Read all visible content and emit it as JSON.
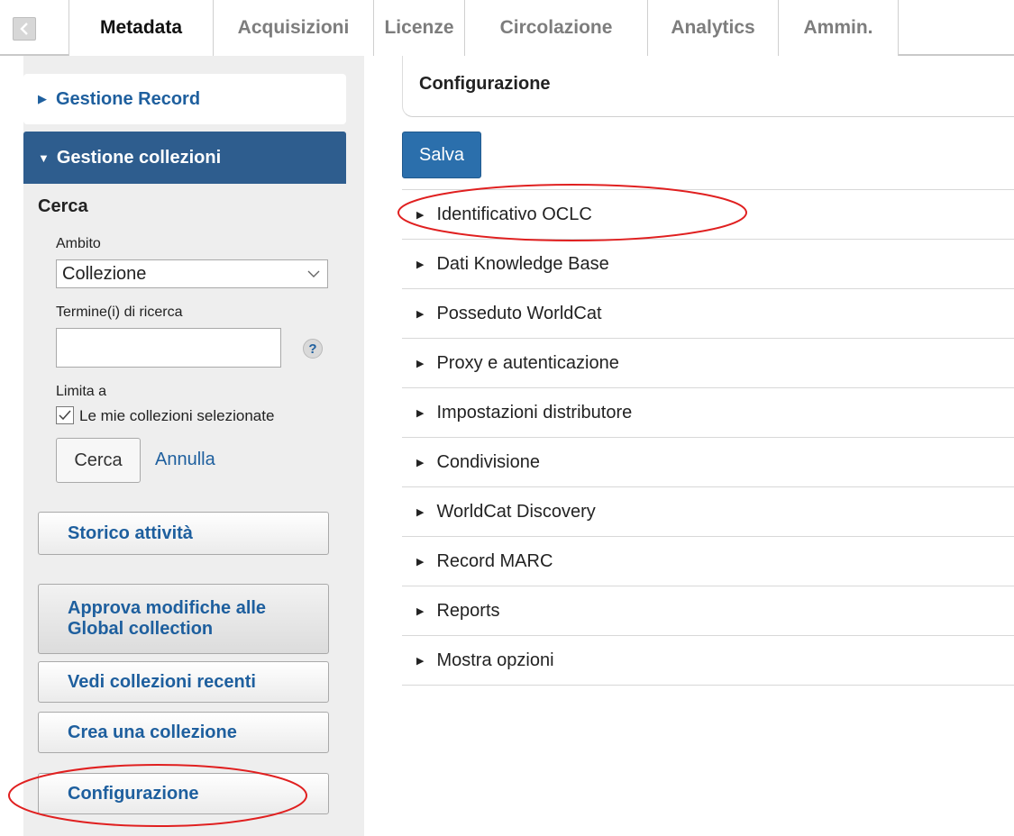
{
  "topbar": {
    "tabs": [
      {
        "label": "Metadata",
        "width": 160,
        "active": true
      },
      {
        "label": "Acquisizioni",
        "width": 178
      },
      {
        "label": "Licenze",
        "width": 101
      },
      {
        "label": "Circolazione",
        "width": 203
      },
      {
        "label": "Analytics",
        "width": 145
      },
      {
        "label": "Ammin.",
        "width": 134
      }
    ]
  },
  "sidebar": {
    "record_panel": "Gestione Record",
    "collections_panel": "Gestione collezioni",
    "search": {
      "title": "Cerca",
      "scope_label": "Ambito",
      "scope_value": "Collezione",
      "terms_label": "Termine(i) di ricerca",
      "terms_value": "",
      "help": "?",
      "limit_label": "Limita a",
      "checkbox_label": "Le mie collezioni selezionate",
      "checkbox_checked": true,
      "search_button": "Cerca",
      "cancel_link": "Annulla"
    },
    "buttons": {
      "history": "Storico attività",
      "approve_line1": "Approva modifiche alle",
      "approve_line2": "Global collection",
      "recent": "Vedi collezioni recenti",
      "create": "Crea una collezione",
      "config": "Configurazione"
    }
  },
  "main": {
    "title": "Configurazione",
    "save_button": "Salva",
    "sections": [
      "Identificativo OCLC",
      "Dati Knowledge Base",
      "Posseduto WorldCat",
      "Proxy e autenticazione",
      "Impostazioni distributore",
      "Condivisione",
      "WorldCat Discovery",
      "Record MARC",
      "Reports",
      "Mostra opzioni"
    ]
  },
  "colors": {
    "accent": "#2e5d8e",
    "link": "#1e5f9e",
    "save": "#2b6fac",
    "annotation": "#e02020"
  },
  "icons": [
    "collapse-left-icon",
    "triangle-right-icon",
    "triangle-down-icon",
    "chevron-down-icon",
    "help-icon",
    "checkmark-icon"
  ]
}
